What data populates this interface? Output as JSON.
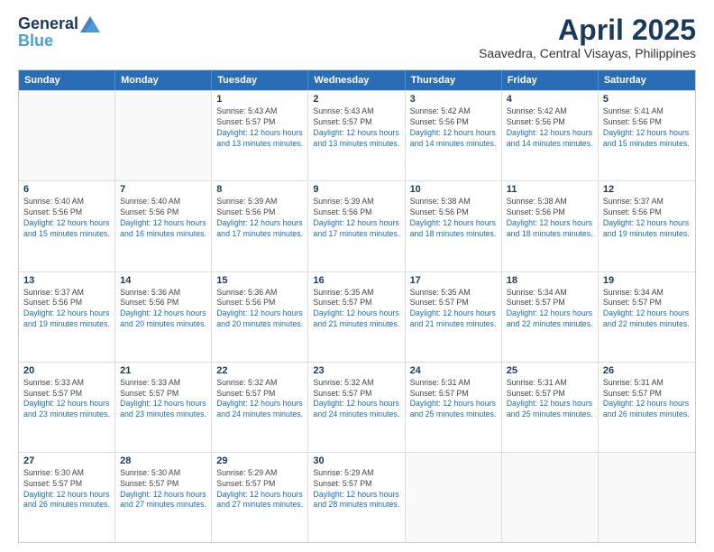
{
  "header": {
    "logo_line1": "General",
    "logo_line2": "Blue",
    "month": "April 2025",
    "location": "Saavedra, Central Visayas, Philippines"
  },
  "days_of_week": [
    "Sunday",
    "Monday",
    "Tuesday",
    "Wednesday",
    "Thursday",
    "Friday",
    "Saturday"
  ],
  "weeks": [
    [
      {
        "day": "",
        "sunrise": "",
        "sunset": "",
        "daylight": "",
        "empty": true
      },
      {
        "day": "",
        "sunrise": "",
        "sunset": "",
        "daylight": "",
        "empty": true
      },
      {
        "day": "1",
        "sunrise": "Sunrise: 5:43 AM",
        "sunset": "Sunset: 5:57 PM",
        "daylight": "Daylight: 12 hours and 13 minutes.",
        "empty": false
      },
      {
        "day": "2",
        "sunrise": "Sunrise: 5:43 AM",
        "sunset": "Sunset: 5:57 PM",
        "daylight": "Daylight: 12 hours and 13 minutes.",
        "empty": false
      },
      {
        "day": "3",
        "sunrise": "Sunrise: 5:42 AM",
        "sunset": "Sunset: 5:56 PM",
        "daylight": "Daylight: 12 hours and 14 minutes.",
        "empty": false
      },
      {
        "day": "4",
        "sunrise": "Sunrise: 5:42 AM",
        "sunset": "Sunset: 5:56 PM",
        "daylight": "Daylight: 12 hours and 14 minutes.",
        "empty": false
      },
      {
        "day": "5",
        "sunrise": "Sunrise: 5:41 AM",
        "sunset": "Sunset: 5:56 PM",
        "daylight": "Daylight: 12 hours and 15 minutes.",
        "empty": false
      }
    ],
    [
      {
        "day": "6",
        "sunrise": "Sunrise: 5:40 AM",
        "sunset": "Sunset: 5:56 PM",
        "daylight": "Daylight: 12 hours and 15 minutes.",
        "empty": false
      },
      {
        "day": "7",
        "sunrise": "Sunrise: 5:40 AM",
        "sunset": "Sunset: 5:56 PM",
        "daylight": "Daylight: 12 hours and 16 minutes.",
        "empty": false
      },
      {
        "day": "8",
        "sunrise": "Sunrise: 5:39 AM",
        "sunset": "Sunset: 5:56 PM",
        "daylight": "Daylight: 12 hours and 17 minutes.",
        "empty": false
      },
      {
        "day": "9",
        "sunrise": "Sunrise: 5:39 AM",
        "sunset": "Sunset: 5:56 PM",
        "daylight": "Daylight: 12 hours and 17 minutes.",
        "empty": false
      },
      {
        "day": "10",
        "sunrise": "Sunrise: 5:38 AM",
        "sunset": "Sunset: 5:56 PM",
        "daylight": "Daylight: 12 hours and 18 minutes.",
        "empty": false
      },
      {
        "day": "11",
        "sunrise": "Sunrise: 5:38 AM",
        "sunset": "Sunset: 5:56 PM",
        "daylight": "Daylight: 12 hours and 18 minutes.",
        "empty": false
      },
      {
        "day": "12",
        "sunrise": "Sunrise: 5:37 AM",
        "sunset": "Sunset: 5:56 PM",
        "daylight": "Daylight: 12 hours and 19 minutes.",
        "empty": false
      }
    ],
    [
      {
        "day": "13",
        "sunrise": "Sunrise: 5:37 AM",
        "sunset": "Sunset: 5:56 PM",
        "daylight": "Daylight: 12 hours and 19 minutes.",
        "empty": false
      },
      {
        "day": "14",
        "sunrise": "Sunrise: 5:36 AM",
        "sunset": "Sunset: 5:56 PM",
        "daylight": "Daylight: 12 hours and 20 minutes.",
        "empty": false
      },
      {
        "day": "15",
        "sunrise": "Sunrise: 5:36 AM",
        "sunset": "Sunset: 5:56 PM",
        "daylight": "Daylight: 12 hours and 20 minutes.",
        "empty": false
      },
      {
        "day": "16",
        "sunrise": "Sunrise: 5:35 AM",
        "sunset": "Sunset: 5:57 PM",
        "daylight": "Daylight: 12 hours and 21 minutes.",
        "empty": false
      },
      {
        "day": "17",
        "sunrise": "Sunrise: 5:35 AM",
        "sunset": "Sunset: 5:57 PM",
        "daylight": "Daylight: 12 hours and 21 minutes.",
        "empty": false
      },
      {
        "day": "18",
        "sunrise": "Sunrise: 5:34 AM",
        "sunset": "Sunset: 5:57 PM",
        "daylight": "Daylight: 12 hours and 22 minutes.",
        "empty": false
      },
      {
        "day": "19",
        "sunrise": "Sunrise: 5:34 AM",
        "sunset": "Sunset: 5:57 PM",
        "daylight": "Daylight: 12 hours and 22 minutes.",
        "empty": false
      }
    ],
    [
      {
        "day": "20",
        "sunrise": "Sunrise: 5:33 AM",
        "sunset": "Sunset: 5:57 PM",
        "daylight": "Daylight: 12 hours and 23 minutes.",
        "empty": false
      },
      {
        "day": "21",
        "sunrise": "Sunrise: 5:33 AM",
        "sunset": "Sunset: 5:57 PM",
        "daylight": "Daylight: 12 hours and 23 minutes.",
        "empty": false
      },
      {
        "day": "22",
        "sunrise": "Sunrise: 5:32 AM",
        "sunset": "Sunset: 5:57 PM",
        "daylight": "Daylight: 12 hours and 24 minutes.",
        "empty": false
      },
      {
        "day": "23",
        "sunrise": "Sunrise: 5:32 AM",
        "sunset": "Sunset: 5:57 PM",
        "daylight": "Daylight: 12 hours and 24 minutes.",
        "empty": false
      },
      {
        "day": "24",
        "sunrise": "Sunrise: 5:31 AM",
        "sunset": "Sunset: 5:57 PM",
        "daylight": "Daylight: 12 hours and 25 minutes.",
        "empty": false
      },
      {
        "day": "25",
        "sunrise": "Sunrise: 5:31 AM",
        "sunset": "Sunset: 5:57 PM",
        "daylight": "Daylight: 12 hours and 25 minutes.",
        "empty": false
      },
      {
        "day": "26",
        "sunrise": "Sunrise: 5:31 AM",
        "sunset": "Sunset: 5:57 PM",
        "daylight": "Daylight: 12 hours and 26 minutes.",
        "empty": false
      }
    ],
    [
      {
        "day": "27",
        "sunrise": "Sunrise: 5:30 AM",
        "sunset": "Sunset: 5:57 PM",
        "daylight": "Daylight: 12 hours and 26 minutes.",
        "empty": false
      },
      {
        "day": "28",
        "sunrise": "Sunrise: 5:30 AM",
        "sunset": "Sunset: 5:57 PM",
        "daylight": "Daylight: 12 hours and 27 minutes.",
        "empty": false
      },
      {
        "day": "29",
        "sunrise": "Sunrise: 5:29 AM",
        "sunset": "Sunset: 5:57 PM",
        "daylight": "Daylight: 12 hours and 27 minutes.",
        "empty": false
      },
      {
        "day": "30",
        "sunrise": "Sunrise: 5:29 AM",
        "sunset": "Sunset: 5:57 PM",
        "daylight": "Daylight: 12 hours and 28 minutes.",
        "empty": false
      },
      {
        "day": "",
        "sunrise": "",
        "sunset": "",
        "daylight": "",
        "empty": true
      },
      {
        "day": "",
        "sunrise": "",
        "sunset": "",
        "daylight": "",
        "empty": true
      },
      {
        "day": "",
        "sunrise": "",
        "sunset": "",
        "daylight": "",
        "empty": true
      }
    ]
  ]
}
